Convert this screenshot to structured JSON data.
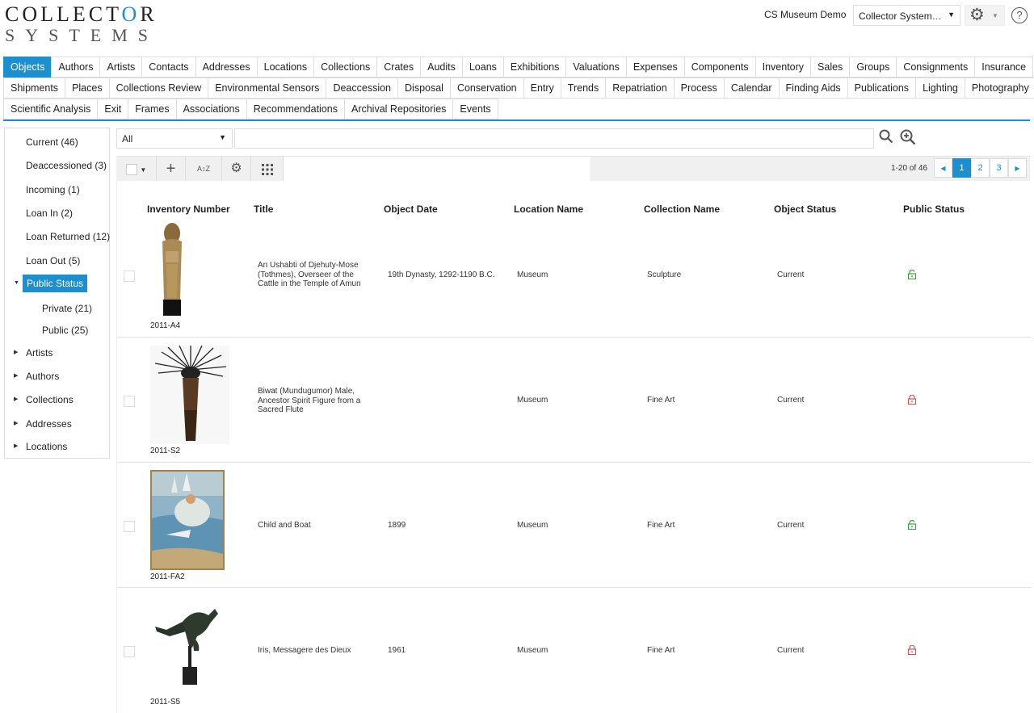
{
  "brand": {
    "line1_pre": "COLLECT",
    "line1_o": "O",
    "line1_post": "R",
    "line2": "SYSTEMS"
  },
  "header": {
    "account": "CS Museum Demo",
    "system_select": "Collector System…",
    "help": "?"
  },
  "tabs": {
    "row1": [
      "Objects",
      "Authors",
      "Artists",
      "Contacts",
      "Addresses",
      "Locations",
      "Collections",
      "Crates",
      "Audits",
      "Loans",
      "Exhibitions",
      "Valuations",
      "Expenses",
      "Components",
      "Inventory",
      "Sales",
      "Groups",
      "Consignments",
      "Insurance"
    ],
    "row2": [
      "Shipments",
      "Places",
      "Collections Review",
      "Environmental Sensors",
      "Deaccession",
      "Disposal",
      "Conservation",
      "Entry",
      "Trends",
      "Repatriation",
      "Process",
      "Calendar",
      "Finding Aids",
      "Publications",
      "Lighting",
      "Photography"
    ],
    "row3": [
      "Scientific Analysis",
      "Exit",
      "Frames",
      "Associations",
      "Recommendations",
      "Archival Repositories",
      "Events"
    ],
    "active": "Objects"
  },
  "sidebar": {
    "items": [
      "Current (46)",
      "Deaccessioned (3)",
      "Incoming (1)",
      "Loan In (2)",
      "Loan Returned (12)",
      "Loan Out (5)"
    ],
    "selected": "Public Status",
    "sub": [
      "Private (21)",
      "Public (25)"
    ],
    "groups": [
      "Artists",
      "Authors",
      "Collections",
      "Addresses",
      "Locations"
    ]
  },
  "filter": {
    "value": "All",
    "search_placeholder": ""
  },
  "toolbar": {
    "sort_label": "A↕Z"
  },
  "pagination": {
    "info": "1-20 of 46",
    "pages": [
      "1",
      "2",
      "3"
    ],
    "current": "1"
  },
  "columns": [
    "Inventory Number",
    "Title",
    "Object Date",
    "Location Name",
    "Collection Name",
    "Object Status",
    "Public Status"
  ],
  "rows": [
    {
      "inv": "2011-A4",
      "title": "An Ushabti of Djehuty-Mose (Tothmes), Overseer of the Cattle in the Temple of Amun",
      "date": "19th Dynasty, 1292-1190 B.C.",
      "location": "Museum",
      "collection": "Sculpture",
      "status": "Current",
      "public": "public"
    },
    {
      "inv": "2011-S2",
      "title": "Biwat (Mundugumor) Male, Ancestor Spirit Figure from a Sacred Flute",
      "date": "",
      "location": "Museum",
      "collection": "Fine Art",
      "status": "Current",
      "public": "private"
    },
    {
      "inv": "2011-FA2",
      "title": "Child and Boat",
      "date": "1899",
      "location": "Museum",
      "collection": "Fine Art",
      "status": "Current",
      "public": "public"
    },
    {
      "inv": "2011-S5",
      "title": "Iris, Messagere des Dieux",
      "date": "1961",
      "location": "Museum",
      "collection": "Fine Art",
      "status": "Current",
      "public": "private"
    }
  ],
  "colors": {
    "accent": "#1c8fd0",
    "public_lock": "#3aa33a",
    "private_lock": "#d9534f"
  }
}
